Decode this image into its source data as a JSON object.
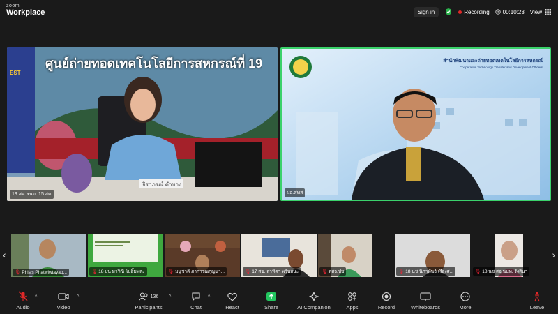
{
  "app": {
    "logo_top": "zoom",
    "logo_bottom": "Workplace"
  },
  "topbar": {
    "signin": "Sign in",
    "recording": "Recording",
    "timer": "00:10:23",
    "view": "View"
  },
  "stage": {
    "tile1": {
      "name": "19 สต.สนม. 15 สต",
      "banner": "ศูนย์ถ่ายทอดเทคโนโลยีการสหกรณ์ที่ 19",
      "nameplate": "จิราภรณ์ คำบาง",
      "side": "EST"
    },
    "tile2": {
      "name": "ผอ.สทส",
      "header_th": "สำนักพัฒนาและถ่ายทอดเทคโนโลยีการสหกรณ์",
      "header_en": "Cooperative Technology Transfer and Development Officers"
    }
  },
  "thumbnails": [
    {
      "name": "Phisis Phatwiwtayap..."
    },
    {
      "name": "18 ปน มาริณี โบอิ้มพละ"
    },
    {
      "name": "มนูชาติ  ภาการณกุญนา..."
    },
    {
      "name": "17 สข. สาทิตา พวันสนะ"
    },
    {
      "name": "สสจ.ปข"
    },
    {
      "name": "18 นช นิภาพันธ์ เรืองส..."
    },
    {
      "name": "18 นช สอ.นนท. รังสินา"
    }
  ],
  "toolbar": {
    "audio": "Audio",
    "video": "Video",
    "participants": "Participants",
    "participants_count": "136",
    "chat": "Chat",
    "react": "React",
    "share": "Share",
    "ai": "AI Companion",
    "apps": "Apps",
    "record": "Record",
    "whiteboards": "Whiteboards",
    "more": "More",
    "leave": "Leave"
  },
  "colors": {
    "accent_green": "#3bd26b",
    "share_green": "#22c55e",
    "leave_red": "#e02828"
  }
}
